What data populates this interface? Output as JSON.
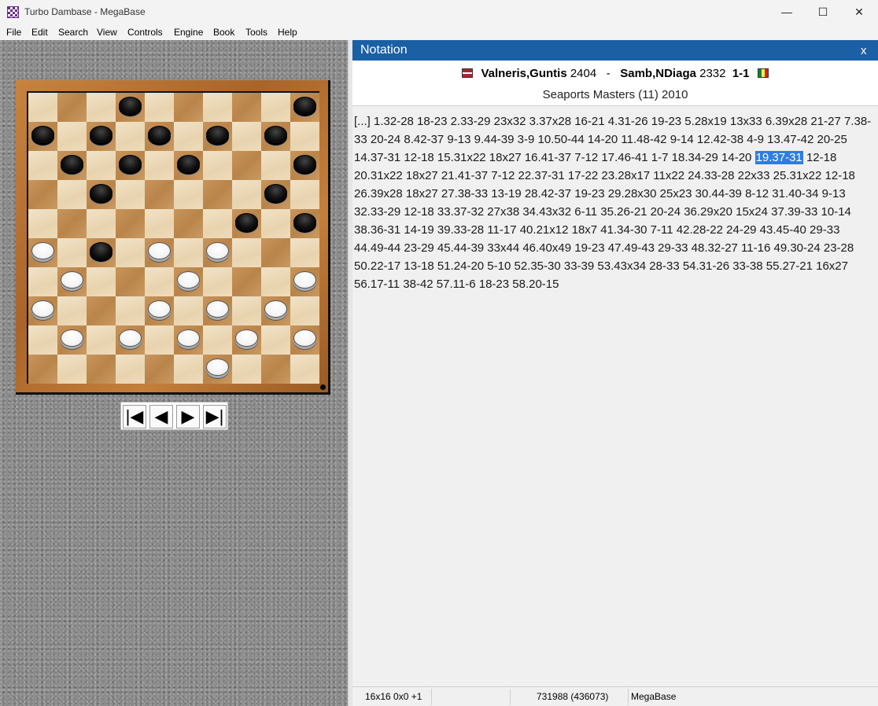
{
  "window": {
    "title": "Turbo Dambase - MegaBase",
    "min_glyph": "—",
    "max_glyph": "☐",
    "close_glyph": "✕"
  },
  "menu": [
    "File",
    "Edit",
    "Search",
    "View",
    "Controls",
    "Engine",
    "Book",
    "Tools",
    "Help"
  ],
  "board": {
    "size": 10,
    "black_squares": [
      4,
      5,
      6,
      7,
      8,
      9,
      10,
      12,
      13,
      14,
      15,
      16,
      17,
      18,
      19,
      20,
      22,
      23,
      24,
      28,
      29,
      32,
      33,
      34,
      35,
      36,
      37,
      38,
      40,
      43,
      44,
      45,
      46,
      47,
      48,
      49,
      50
    ],
    "black_pieces": [
      2,
      5,
      6,
      7,
      8,
      9,
      12,
      13,
      14,
      15,
      17,
      23,
      28,
      29,
      33
    ],
    "white_pieces": [
      31,
      32,
      34,
      35,
      37,
      38,
      41,
      42,
      44,
      45,
      47,
      48,
      49,
      50,
      52
    ],
    "piece_layout": {
      "black": [
        [
          0,
          3
        ],
        [
          0,
          9
        ],
        [
          1,
          0
        ],
        [
          1,
          2
        ],
        [
          1,
          4
        ],
        [
          1,
          6
        ],
        [
          1,
          8
        ],
        [
          2,
          1
        ],
        [
          2,
          3
        ],
        [
          2,
          5
        ],
        [
          2,
          9
        ],
        [
          3,
          2
        ],
        [
          3,
          8
        ],
        [
          4,
          7
        ],
        [
          4,
          9
        ],
        [
          5,
          2
        ]
      ],
      "white": [
        [
          5,
          0
        ],
        [
          5,
          4
        ],
        [
          5,
          6
        ],
        [
          6,
          1
        ],
        [
          6,
          5
        ],
        [
          6,
          9
        ],
        [
          7,
          0
        ],
        [
          7,
          4
        ],
        [
          7,
          6
        ],
        [
          7,
          8
        ],
        [
          8,
          1
        ],
        [
          8,
          3
        ],
        [
          8,
          5
        ],
        [
          8,
          7
        ],
        [
          8,
          9
        ],
        [
          9,
          6
        ]
      ]
    }
  },
  "navigation": {
    "first": "|◀",
    "prev": "◀",
    "next": "▶",
    "last": "▶|"
  },
  "notation": {
    "title": "Notation",
    "close": "x",
    "white_player": "Valneris,Guntis",
    "white_rating": "2404",
    "separator": "-",
    "black_player": "Samb,NDiaga",
    "black_rating": "2332",
    "result": "1-1",
    "event": "Seaports Masters (11) 2010",
    "moves_before": "[...] 1.32-28 18-23 2.33-29 23x32 3.37x28 16-21 4.31-26 19-23 5.28x19 13x33 6.39x28 21-27 7.38-33 20-24 8.42-37 9-13 9.44-39 3-9 10.50-44 14-20 11.48-42 9-14 12.42-38 4-9 13.47-42 20-25 14.37-31 12-18 15.31x22 18x27 16.41-37 7-12 17.46-41 1-7 18.34-29 14-20 ",
    "moves_highlight": "19.37-31",
    "moves_after": " 12-18 20.31x22 18x27 21.41-37 7-12 22.37-31 17-22 23.28x17 11x22 24.33-28 22x33 25.31x22 12-18 26.39x28 18x27 27.38-33 13-19 28.42-37 19-23 29.28x30 25x23 30.44-39 8-12 31.40-34 9-13 32.33-29 12-18 33.37-32 27x38 34.43x32 6-11 35.26-21 20-24 36.29x20 15x24 37.39-33 10-14 38.36-31 14-19 39.33-28 11-17 40.21x12 18x7 41.34-30 7-11 42.28-22 24-29 43.45-40 29-33 44.49-44 23-29 45.44-39 33x44 46.40x49 19-23 47.49-43 29-33 48.32-27 11-16 49.30-24 23-28 50.22-17 13-18 51.24-20 5-10 52.35-30 33-39 53.43x34 28-33 54.31-26 33-38 55.27-21 16x27 56.17-11 38-42 57.11-6 18-23 58.20-15"
  },
  "status": {
    "cell1": "16x16 0x0 +1",
    "cell2": "",
    "cell3": "731988 (436073)",
    "cell4": "MegaBase"
  }
}
